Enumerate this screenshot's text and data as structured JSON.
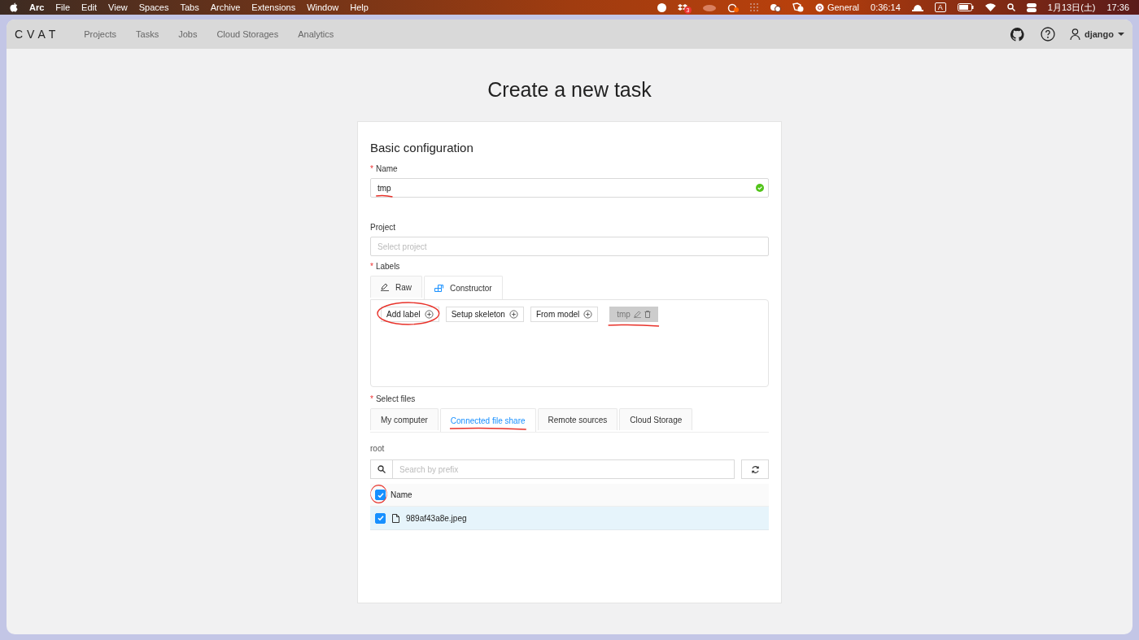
{
  "menu_bar": {
    "app": "Arc",
    "menus": [
      "File",
      "Edit",
      "View",
      "Spaces",
      "Tabs",
      "Archive",
      "Extensions",
      "Window",
      "Help"
    ],
    "badge": "3",
    "focus_label": "General",
    "timer": "0:36:14",
    "input_indicator": "A",
    "date": "1月13日(土)",
    "time": "17:36"
  },
  "header": {
    "logo": "CVAT",
    "nav": [
      "Projects",
      "Tasks",
      "Jobs",
      "Cloud Storages",
      "Analytics"
    ],
    "user": "django"
  },
  "title": "Create a new task",
  "form": {
    "section": "Basic configuration",
    "name_field": {
      "label": "Name",
      "required_mark": "*",
      "value": "tmp",
      "valid": true,
      "underlined": true
    },
    "project_field": {
      "label": "Project",
      "placeholder": "Select project"
    },
    "labels": {
      "label": "Labels",
      "required_mark": "*",
      "tabs": [
        {
          "label": "Raw",
          "kind": "pencil",
          "selected": false
        },
        {
          "label": "Constructor",
          "kind": "blocks",
          "selected": true
        }
      ],
      "actions": [
        {
          "label": "Add label",
          "circled": true
        },
        {
          "label": "Setup skeleton",
          "circled": false
        },
        {
          "label": "From model",
          "circled": false
        }
      ],
      "items": [
        {
          "name": "tmp",
          "underlined": true
        }
      ]
    },
    "files": {
      "label": "Select files",
      "required_mark": "*",
      "tabs": [
        {
          "label": "My computer",
          "selected": false,
          "underlined": false
        },
        {
          "label": "Connected file share",
          "selected": true,
          "underlined": true
        },
        {
          "label": "Remote sources",
          "selected": false,
          "underlined": false
        },
        {
          "label": "Cloud Storage",
          "selected": false,
          "underlined": false
        }
      ],
      "path": "root",
      "search_placeholder": "Search by prefix",
      "header": {
        "checked": true,
        "column": "Name",
        "circled": true
      },
      "rows": [
        {
          "name": "989af43a8e.jpeg",
          "checked": true,
          "selected": true
        }
      ]
    }
  }
}
